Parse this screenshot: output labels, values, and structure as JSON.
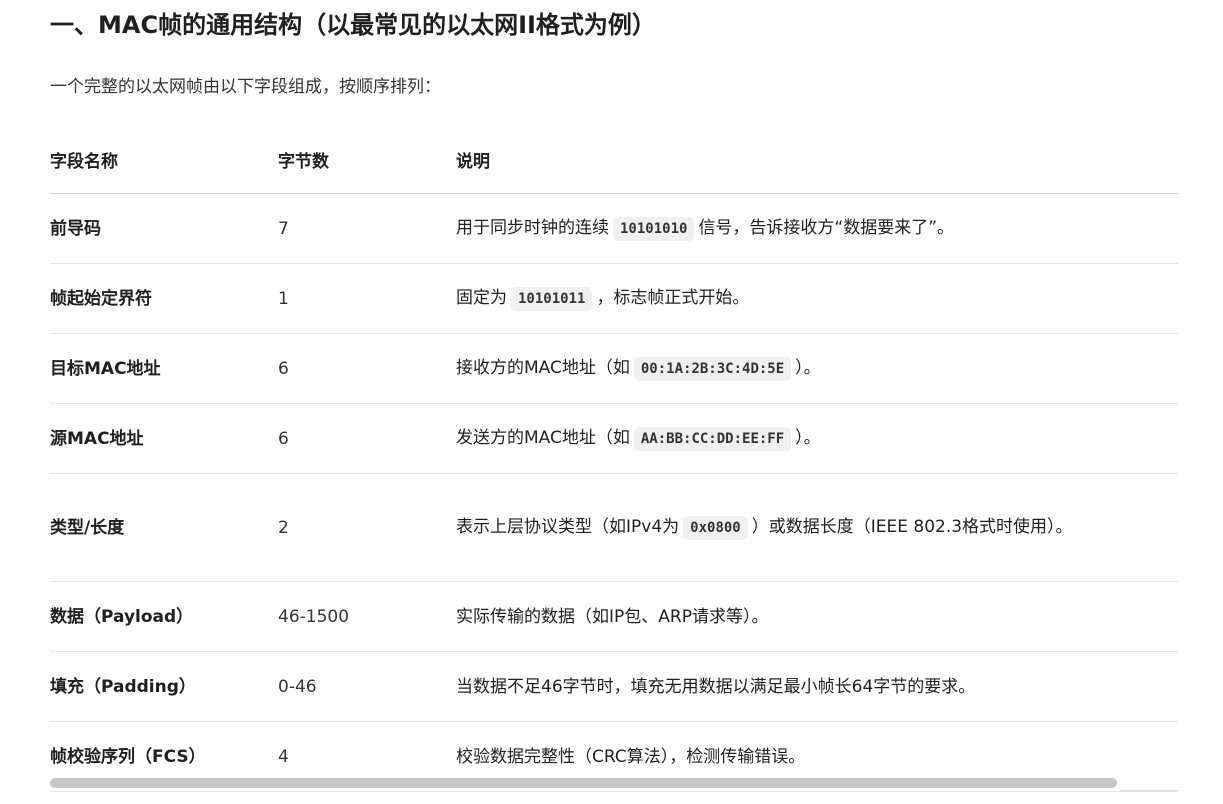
{
  "section": {
    "title": "一、MAC帧的通用结构（以最常见的以太网II格式为例）",
    "intro": "一个完整的以太网帧由以下字段组成，按顺序排列："
  },
  "table": {
    "headers": [
      "字段名称",
      "字节数",
      "说明"
    ],
    "rows": [
      {
        "name": "前导码",
        "bytes": "7",
        "desc_before": "用于同步时钟的连续",
        "code": "10101010",
        "desc_after": "信号，告诉接收方“数据要来了”。"
      },
      {
        "name": "帧起始定界符",
        "bytes": "1",
        "desc_before": "固定为",
        "code": "10101011",
        "desc_after": "，标志帧正式开始。"
      },
      {
        "name": "目标MAC地址",
        "bytes": "6",
        "desc_before": "接收方的MAC地址（如",
        "code": "00:1A:2B:3C:4D:5E",
        "desc_after": "）。"
      },
      {
        "name": "源MAC地址",
        "bytes": "6",
        "desc_before": "发送方的MAC地址（如",
        "code": "AA:BB:CC:DD:EE:FF",
        "desc_after": "）。"
      },
      {
        "name": "类型/长度",
        "bytes": "2",
        "desc_before": "表示上层协议类型（如IPv4为",
        "code": "0x0800",
        "desc_after": "）或数据长度（IEEE 802.3格式时使用）。"
      },
      {
        "name": "数据（Payload）",
        "bytes": "46-1500",
        "desc_before": "实际传输的数据（如IP包、ARP请求等）。",
        "code": "",
        "desc_after": ""
      },
      {
        "name": "填充（Padding）",
        "bytes": "0-46",
        "desc_before": "当数据不足46字节时，填充无用数据以满足最小帧长64字节的要求。",
        "code": "",
        "desc_after": ""
      },
      {
        "name": "帧校验序列（FCS）",
        "bytes": "4",
        "desc_before": "校验数据完整性（CRC算法），检测传输错误。",
        "code": "",
        "desc_after": ""
      }
    ]
  }
}
